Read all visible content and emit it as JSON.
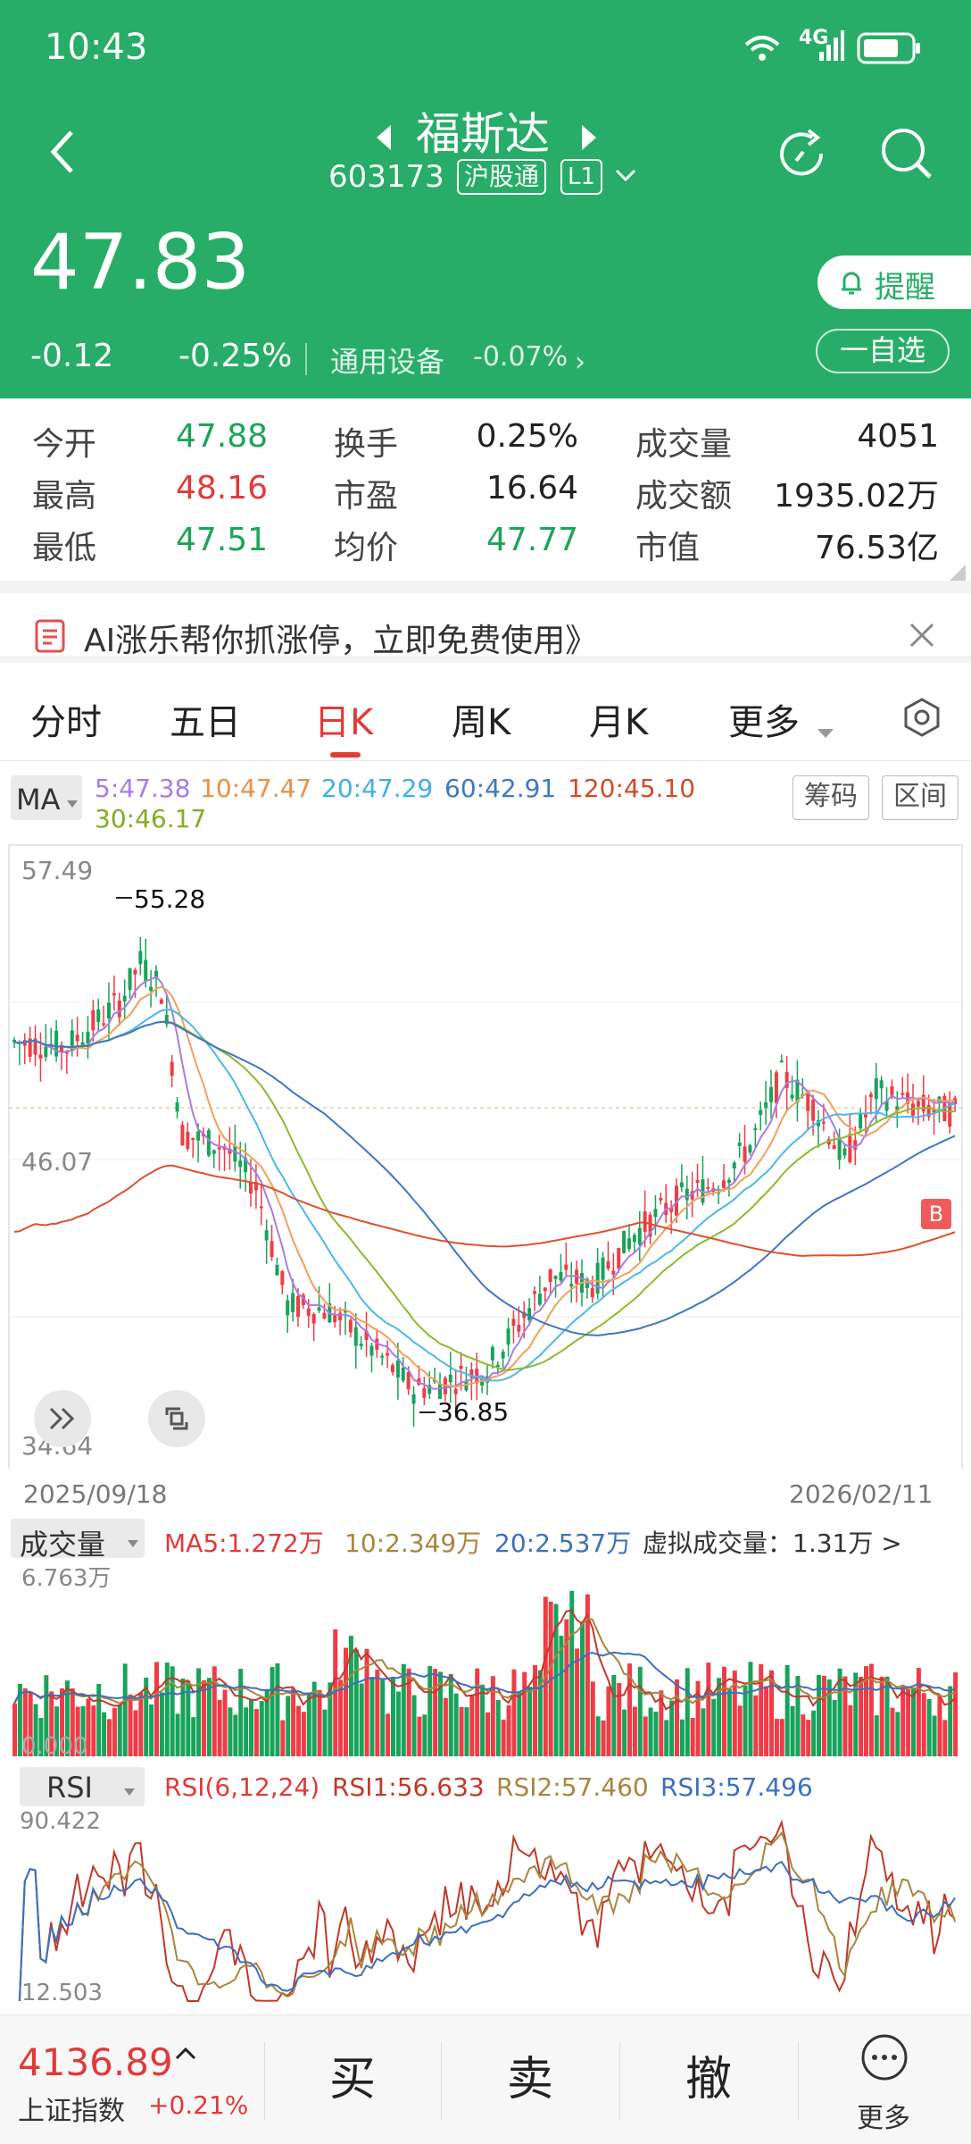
{
  "status": {
    "time": "10:43",
    "network": "4G",
    "signal": "6"
  },
  "header": {
    "name": "福斯达",
    "code": "603173",
    "tag": "沪股通",
    "level": "L1",
    "price": "47.83",
    "change": "-0.12",
    "change_pct": "-0.25%",
    "sector": "通用设备",
    "sector_pct": "-0.07%",
    "alert_label": "提醒",
    "fav_label": "一自选"
  },
  "stats": {
    "rows": [
      {
        "l1": "今开",
        "v1": "47.88",
        "l2": "换手",
        "v2": "0.25%",
        "l3": "成交量",
        "v3": "4051"
      },
      {
        "l1": "最高",
        "v1": "48.16",
        "l2": "市盈",
        "v2": "16.64",
        "l3": "成交额",
        "v3": "1935.02万"
      },
      {
        "l1": "最低",
        "v1": "47.51",
        "l2": "均价",
        "v2": "47.77",
        "l3": "市值",
        "v3": "76.53亿"
      }
    ]
  },
  "banner": {
    "text": "AI涨乐帮你抓涨停，立即免费使用》"
  },
  "tabs": {
    "items": [
      "分时",
      "五日",
      "日K",
      "周K",
      "月K",
      "更多"
    ],
    "active": "日K"
  },
  "ma": {
    "selector": "MA",
    "ma5": "5:47.38",
    "ma10": "10:47.47",
    "ma20": "20:47.29",
    "ma60": "60:42.91",
    "ma120": "120:45.10",
    "ma30": "30:46.17",
    "chips_label": "筹码",
    "range_label": "区间"
  },
  "kline": {
    "y_top": "57.49",
    "y_mid": "46.07",
    "y_bottom": "34.64",
    "high_label": "55.28",
    "low_label": "36.85",
    "date_start": "2025/09/18",
    "date_end": "2026/02/11",
    "buy_mark": "B"
  },
  "volume": {
    "selector": "成交量",
    "ma5": "MA5:1.272万",
    "ma10": "10:2.349万",
    "ma20": "20:2.537万",
    "virtual": "虚拟成交量：1.31万 >",
    "y_top": "6.763万",
    "y_bottom": "0.000"
  },
  "rsi": {
    "selector": "RSI",
    "params": "RSI(6,12,24)",
    "rsi1": "RSI1:56.633",
    "rsi2": "RSI2:57.460",
    "rsi3": "RSI3:57.496",
    "y_top": "90.422",
    "y_bottom": "12.503"
  },
  "bottom": {
    "index_value": "4136.89",
    "index_name": "上证指数",
    "index_pct": "+0.21%",
    "buy": "买",
    "sell": "卖",
    "cancel": "撤",
    "more": "更多"
  },
  "colors": {
    "header_bg": "#27ad67",
    "up": "#f03c46",
    "down": "#18a35a",
    "ma5": "#a77de0",
    "ma10": "#f2a05a",
    "ma20": "#4fb7e8",
    "ma60": "#3d78c4",
    "ma120": "#e0502a",
    "ma30": "#8dba2e"
  }
}
